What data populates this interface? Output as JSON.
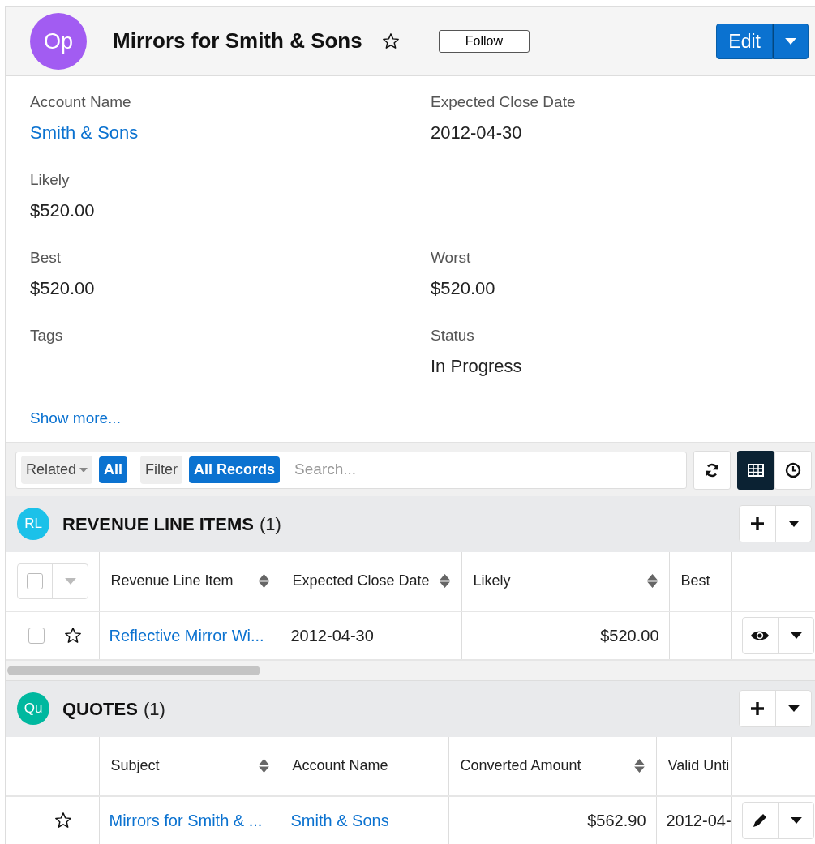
{
  "header": {
    "avatar": "Op",
    "title": "Mirrors for Smith & Sons",
    "starred": false,
    "follow": "Follow",
    "edit": "Edit"
  },
  "field_rows": [
    [
      {
        "label": "Account Name",
        "value": "Smith & Sons",
        "kind": "link"
      },
      {
        "label": "Expected Close Date",
        "value": "2012-04-30",
        "kind": "text"
      }
    ],
    [
      {
        "label": "Likely",
        "value": "$520.00",
        "kind": "text"
      }
    ],
    [
      {
        "label": "Best",
        "value": "$520.00",
        "kind": "text"
      },
      {
        "label": "Worst",
        "value": "$520.00",
        "kind": "text"
      }
    ],
    [
      {
        "label": "Tags"
      },
      {
        "label": "Status",
        "value": "In Progress",
        "kind": "text"
      }
    ]
  ],
  "show_more": "Show more...",
  "toolbar": {
    "related": "Related",
    "related_badge": "All",
    "filter": "Filter",
    "filter_badge": "All Records",
    "search": {
      "placeholder": "Search..."
    },
    "views": [
      {
        "kind": "list",
        "selected": true
      },
      {
        "kind": "timeline",
        "selected": false
      }
    ]
  },
  "subpanels": [
    {
      "avatar": "RL",
      "color": "#1bc1e9",
      "title": "REVENUE LINE ITEMS",
      "count": "(1)",
      "select_all": true,
      "select_all_checked": false,
      "scrollbar": true,
      "columns": [
        {
          "label": "Revenue Line Item",
          "sortable": true
        },
        {
          "label": "Expected Close Date",
          "sortable": true
        },
        {
          "label": "Likely",
          "sortable": true
        },
        {
          "label": "Best",
          "sortable": false
        }
      ],
      "rows": [
        {
          "checked": false,
          "starred": false,
          "kind": "view",
          "cells": [
            {
              "text": "Reflective Mirror Wi...",
              "kind": "link"
            },
            {
              "text": "2012-04-30",
              "kind": "text"
            },
            {
              "text": "$520.00",
              "kind": "number"
            },
            {
              "kind": "text"
            }
          ]
        }
      ]
    },
    {
      "avatar": "Qu",
      "color": "#00b89f",
      "title": "QUOTES",
      "count": "(1)",
      "select_all": false,
      "scrollbar": false,
      "columns": [
        {
          "label": "Subject",
          "sortable": true
        },
        {
          "label": "Account Name",
          "sortable": false
        },
        {
          "label": "Converted Amount",
          "sortable": true
        },
        {
          "label": "Valid Unti",
          "sortable": false
        }
      ],
      "rows": [
        {
          "starred": false,
          "kind": "edit",
          "cells": [
            {
              "text": "Mirrors for Smith & ...",
              "kind": "link"
            },
            {
              "text": "Smith & Sons",
              "kind": "link"
            },
            {
              "text": "$562.90",
              "kind": "number"
            },
            {
              "text": "2012-04-",
              "kind": "text"
            }
          ]
        }
      ]
    }
  ]
}
